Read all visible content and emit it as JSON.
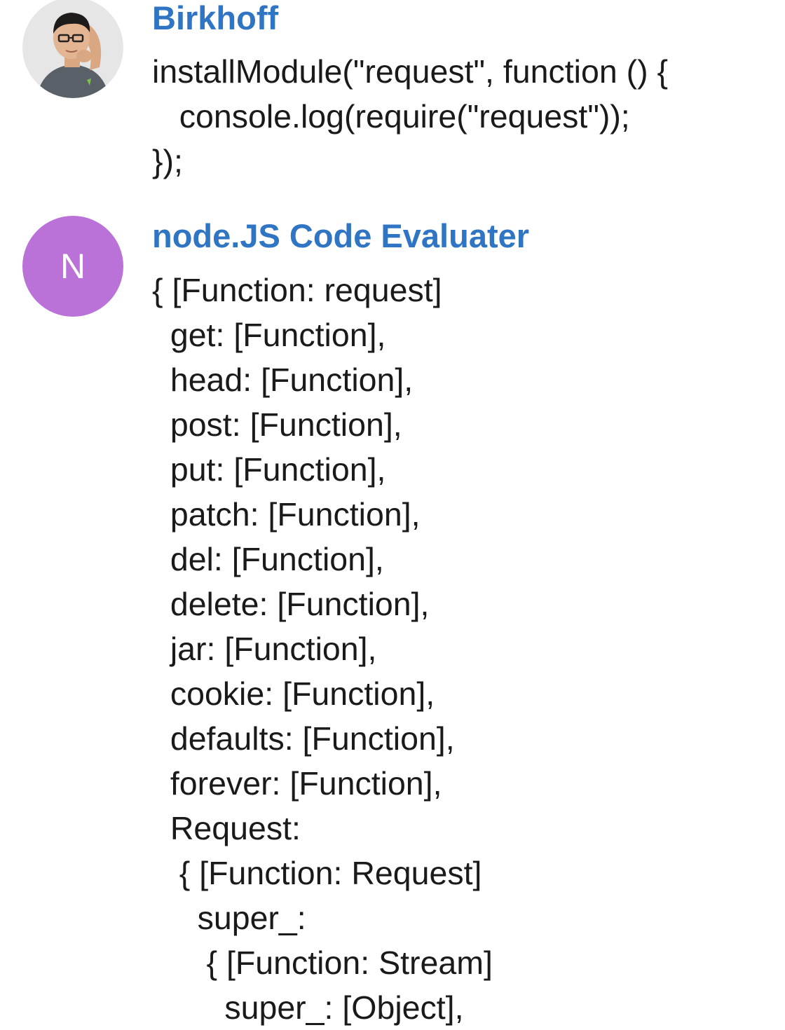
{
  "messages": [
    {
      "sender": "Birkhoff",
      "avatar_type": "photo",
      "text": "installModule(\"request\", function () {\n   console.log(require(\"request\"));\n});"
    },
    {
      "sender": "node.JS Code Evaluater",
      "avatar_type": "initial",
      "avatar_initial": "N",
      "avatar_color": "#bb72d8",
      "text": "{ [Function: request]\n  get: [Function],\n  head: [Function],\n  post: [Function],\n  put: [Function],\n  patch: [Function],\n  del: [Function],\n  delete: [Function],\n  jar: [Function],\n  cookie: [Function],\n  defaults: [Function],\n  forever: [Function],\n  Request:\n   { [Function: Request]\n     super_:\n      { [Function: Stream]\n        super_: [Object],"
    }
  ],
  "colors": {
    "sender_name": "#2f75c3",
    "message_text": "#1a1a1a",
    "background": "#ffffff"
  }
}
